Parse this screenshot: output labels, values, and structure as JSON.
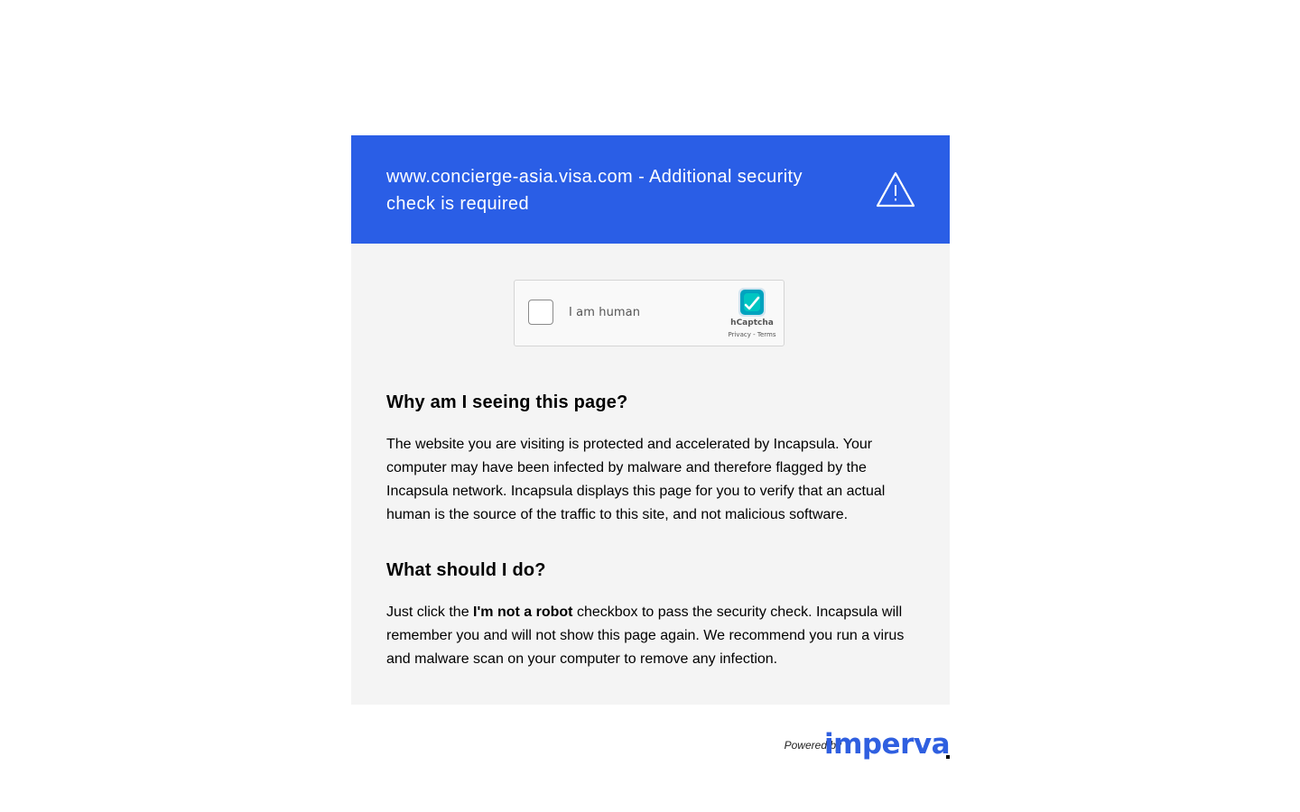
{
  "banner": {
    "title": "www.concierge-asia.visa.com - Additional security check is required",
    "icon": "warning-triangle-icon",
    "bg_color": "#2a5ee6"
  },
  "captcha": {
    "label": "I am human",
    "brand": "hCaptcha",
    "privacy_label": "Privacy",
    "separator": " - ",
    "terms_label": "Terms",
    "icon": "hcaptcha-logo-icon",
    "checked": false
  },
  "why": {
    "heading": "Why am I seeing this page?",
    "body": "The website you are visiting is protected and accelerated by Incapsula. Your computer may have been infected by malware and therefore flagged by the Incapsula network. Incapsula displays this page for you to verify that an actual human is the source of the traffic to this site, and not malicious software."
  },
  "what": {
    "heading": "What should I do?",
    "body_prefix": "Just click the ",
    "body_bold": "I'm not a robot",
    "body_suffix": " checkbox to pass the security check. Incapsula will remember you and will not show this page again. We recommend you run a virus and malware scan on your computer to remove any infection."
  },
  "footer": {
    "powered_by": "Powered by",
    "brand": "imperva",
    "brand_color": "#2f5fe0"
  }
}
